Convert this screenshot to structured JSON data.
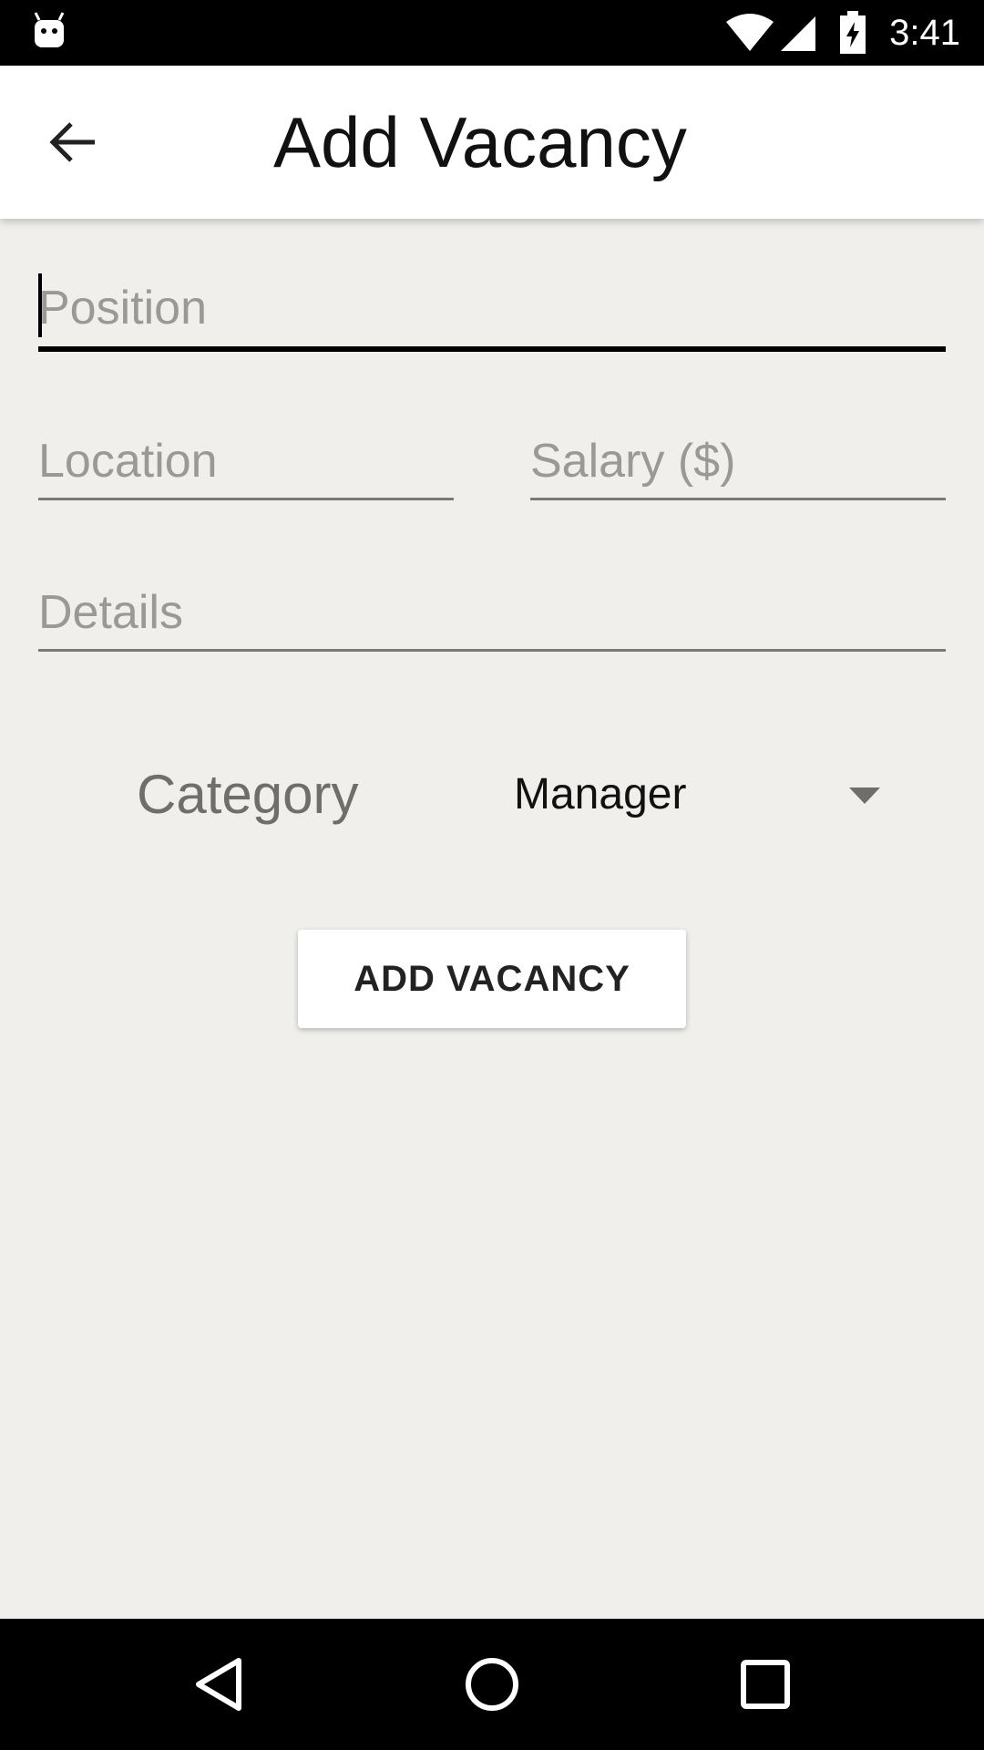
{
  "status_bar": {
    "time": "3:41",
    "icons": [
      "android-icon",
      "wifi-icon",
      "signal-icon",
      "battery-charging-icon"
    ]
  },
  "app_bar": {
    "title": "Add Vacancy",
    "back_icon": "arrow-back-icon"
  },
  "form": {
    "position": {
      "value": "",
      "placeholder": "Position"
    },
    "location": {
      "value": "",
      "placeholder": "Location"
    },
    "salary": {
      "value": "",
      "placeholder": "Salary ($)"
    },
    "details": {
      "value": "",
      "placeholder": "Details"
    },
    "category_label": "Category",
    "category_selected": "Manager",
    "submit_label": "ADD VACANCY"
  },
  "nav_bar": {
    "icons": [
      "back-triangle-icon",
      "home-circle-icon",
      "recents-square-icon"
    ]
  },
  "colors": {
    "background": "#f0efec",
    "app_bar": "#ffffff",
    "placeholder": "#9a9996",
    "underline": "#7b7a77",
    "focused_underline": "#000000"
  }
}
